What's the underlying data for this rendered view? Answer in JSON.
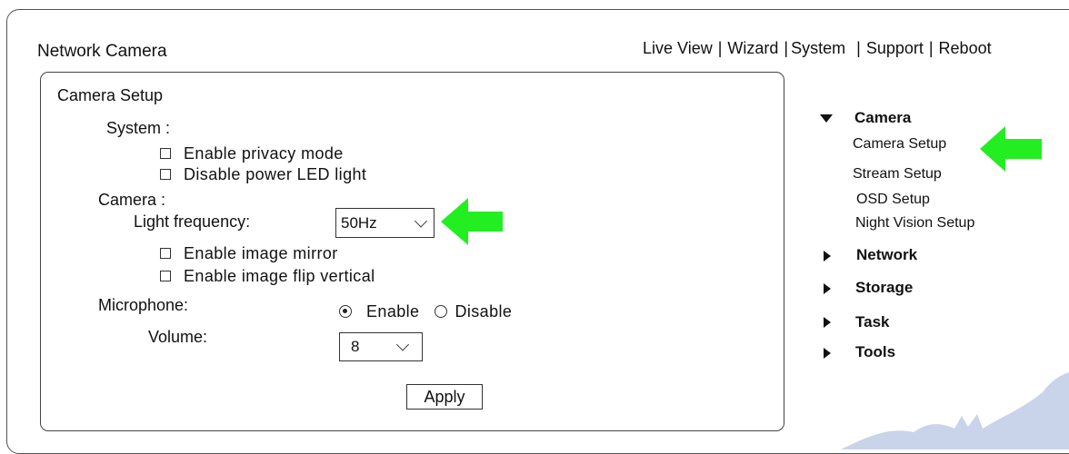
{
  "app": {
    "title": "Network Camera"
  },
  "topnav": [
    "Live View",
    "Wizard",
    "System",
    "Support",
    "Reboot"
  ],
  "setup": {
    "title": "Camera Setup",
    "system_label": "System :",
    "privacy_mode": "Enable privacy mode",
    "power_led": "Disable power LED light",
    "camera_label": "Camera :",
    "light_freq_label": "Light frequency:",
    "light_freq_value": "50Hz",
    "image_mirror": "Enable image mirror",
    "image_flip": "Enable image flip vertical",
    "microphone_label": "Microphone:",
    "mic_enable": "Enable",
    "mic_disable": "Disable",
    "volume_label": "Volume:",
    "volume_value": "8",
    "apply_label": "Apply"
  },
  "sidebar": {
    "camera": "Camera",
    "camera_items": [
      "Camera Setup",
      "Stream Setup",
      "OSD Setup",
      "Night Vision Setup"
    ],
    "network": "Network",
    "storage": "Storage",
    "task": "Task",
    "tools": "Tools"
  },
  "colors": {
    "arrow": "#22ee22",
    "watermark": "#c9d4ea"
  }
}
